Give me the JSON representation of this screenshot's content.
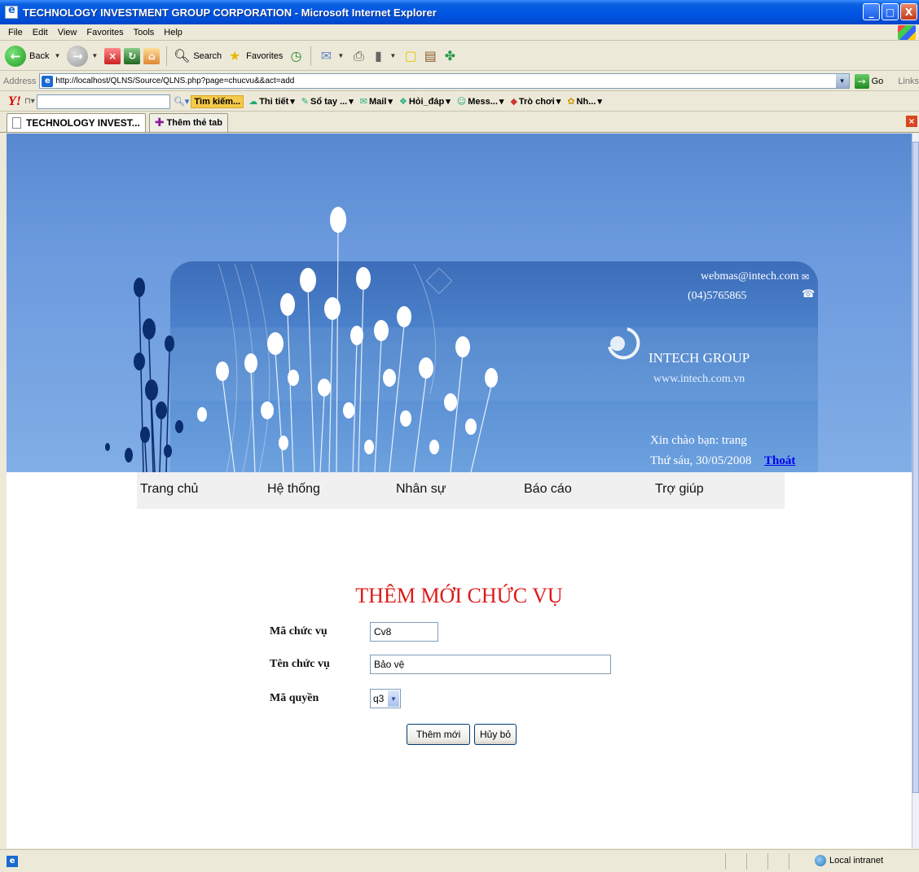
{
  "window": {
    "title": "TECHNOLOGY INVESTMENT GROUP CORPORATION - Microsoft Internet Explorer",
    "controls": [
      "_",
      "□",
      "X"
    ]
  },
  "menu": {
    "items": [
      "File",
      "Edit",
      "View",
      "Favorites",
      "Tools",
      "Help"
    ]
  },
  "toolbar": {
    "back": "Back",
    "search": "Search",
    "favorites": "Favorites"
  },
  "address": {
    "label": "Address",
    "url": "http://localhost/QLNS/Source/QLNS.php?page=chucvu&&act=add",
    "go": "Go",
    "links": "Links"
  },
  "yahoo": {
    "search_button": "Tìm kiếm...",
    "items": [
      "Thi tiết",
      "Sổ tay ...",
      "Mail",
      "Hỏi_đáp",
      "Mess...",
      "Trò chơi",
      "Nh..."
    ]
  },
  "tabs": {
    "active": "TECHNOLOGY INVEST...",
    "new_tab": "Thêm thẻ tab"
  },
  "banner": {
    "email": "webmas@intech.com",
    "phone": "(04)5765865",
    "company": "INTECH GROUP",
    "website": "www.intech.com.vn",
    "greeting": "Xin chào bạn: trang",
    "date": "Thứ sáu, 30/05/2008",
    "logout": "Thoát"
  },
  "nav": {
    "items": [
      "Trang chủ",
      "Hệ thống",
      "Nhân sự",
      "Báo cáo",
      "Trợ giúp"
    ]
  },
  "form": {
    "title": "THÊM MỚI CHỨC VỤ",
    "code_label": "Mã chức vụ",
    "code_value": "Cv8",
    "name_label": "Tên chức vụ",
    "name_value": "Bảo vệ",
    "perm_label": "Mã quyền",
    "perm_value": "q3",
    "add_button": "Thêm mới",
    "cancel_button": "Hủy bỏ"
  },
  "status": {
    "zone": "Local intranet"
  }
}
